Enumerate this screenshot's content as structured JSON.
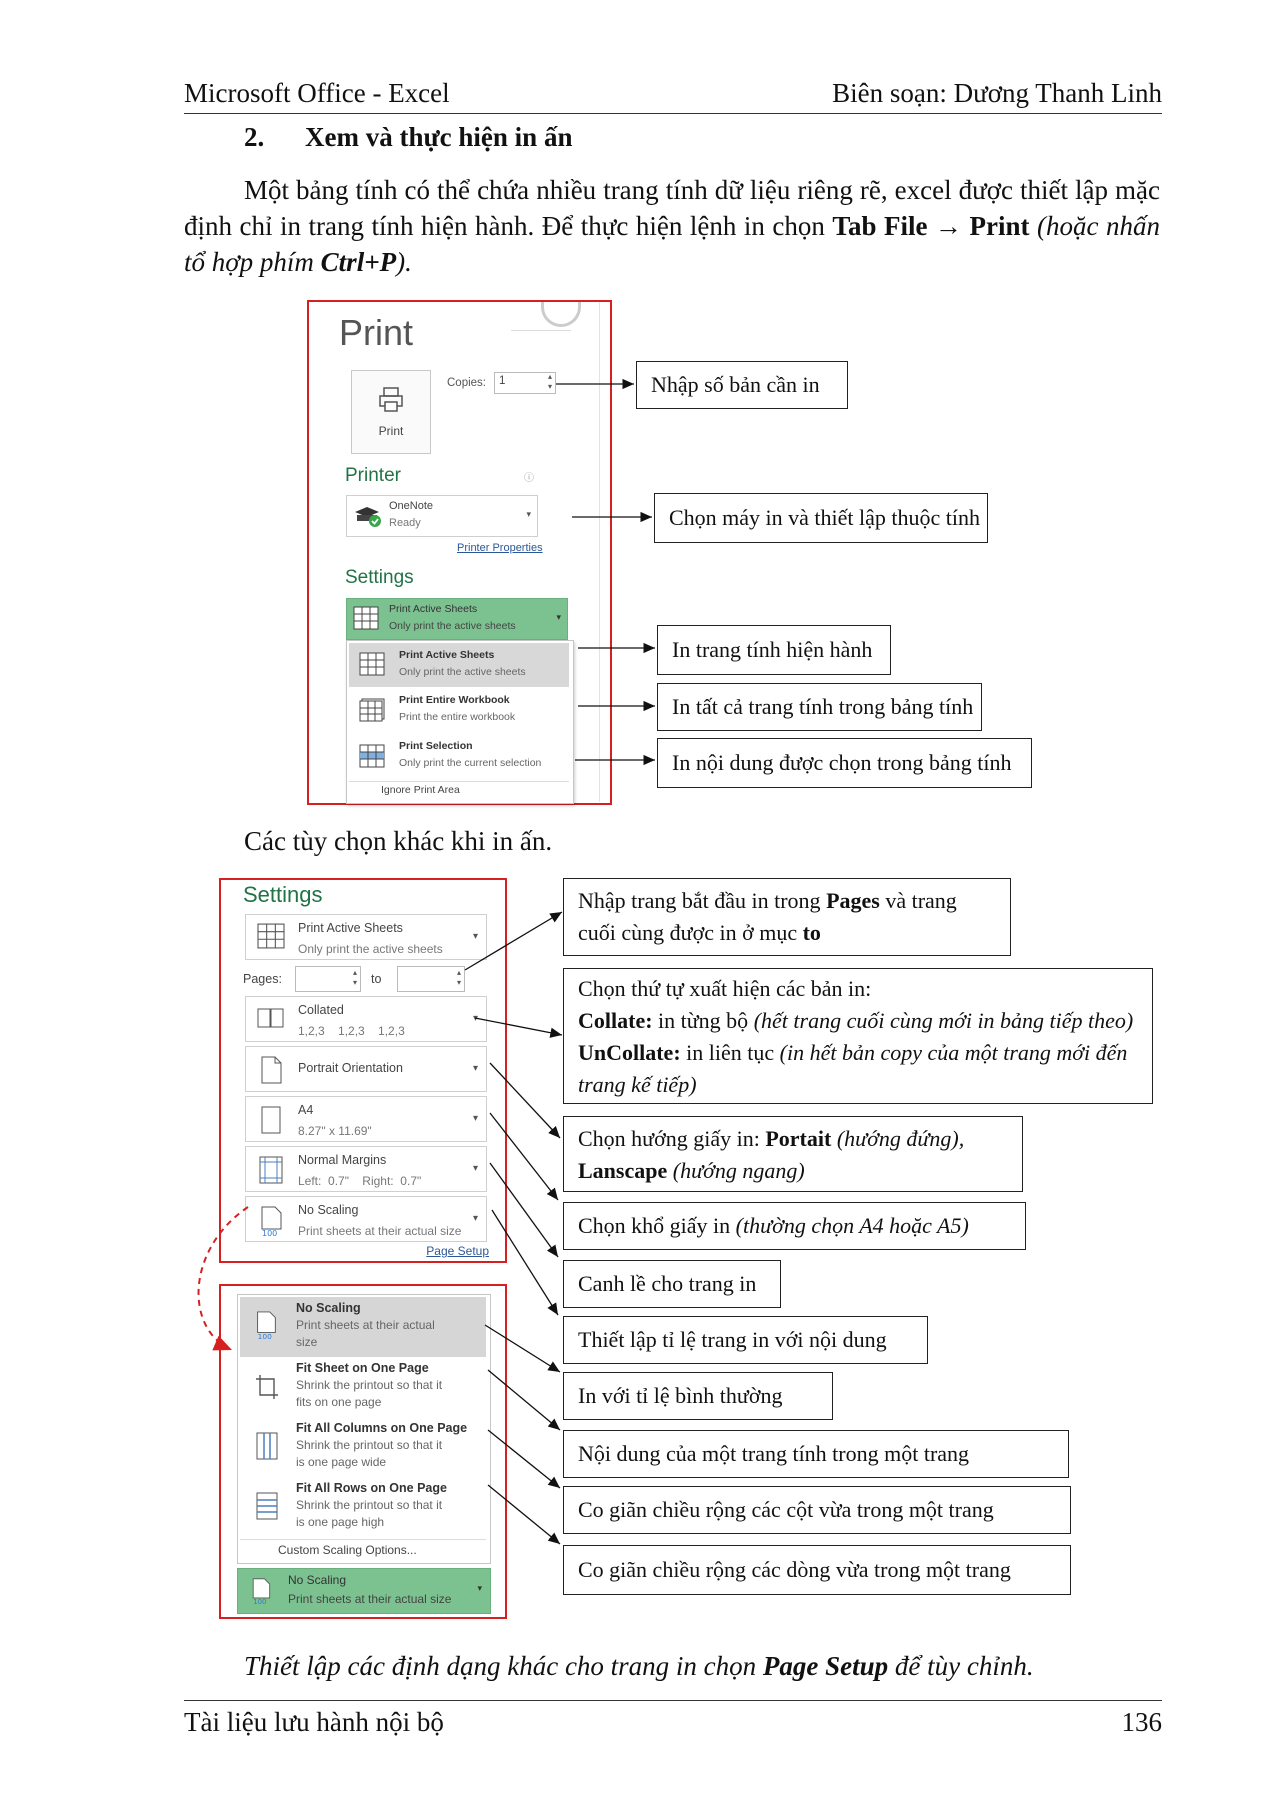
{
  "header": {
    "left": "Microsoft Office - Excel",
    "right": "Biên soạn: Dương Thanh Linh"
  },
  "section": {
    "number": "2.",
    "title": "Xem và thực hiện in ấn"
  },
  "intro": {
    "s1": "Một bảng tính có thể chứa nhiều trang tính dữ liệu riêng rẽ, excel được thiết lập mặc định chỉ in trang tính hiện hành. Để thực hiện lệnh in chọn ",
    "tab_file": "Tab File",
    "arrow": "→",
    "print_word": "Print",
    "s2": " (hoặc nhấn tổ hợp phím ",
    "shortcut": "Ctrl+P",
    "s3": ")."
  },
  "fig1": {
    "title": "Print",
    "copies_label": "Copies:",
    "copies_value": "1",
    "print_button": "Print",
    "printer_heading": "Printer",
    "printer_name": "OneNote",
    "printer_status": "Ready",
    "printer_properties": "Printer Properties",
    "settings_heading": "Settings",
    "active_line1": "Print Active Sheets",
    "active_line2": "Only print the active sheets",
    "menu": [
      {
        "t1": "Print Active Sheets",
        "t2": "Only print the active sheets"
      },
      {
        "t1": "Print Entire Workbook",
        "t2": "Print the entire workbook"
      },
      {
        "t1": "Print Selection",
        "t2": "Only print the current selection"
      }
    ],
    "ignore": "Ignore Print Area",
    "callouts": [
      "Nhập số bản cần in",
      "Chọn máy in và thiết lập thuộc tính",
      "In trang tính hiện hành",
      "In tất cả trang tính trong bảng tính",
      "In nội dung được chọn trong bảng tính"
    ]
  },
  "other_options": "Các tùy chọn khác khi in ấn.",
  "fig2": {
    "settings_heading": "Settings",
    "active_line1": "Print Active Sheets",
    "active_line2": "Only print the active sheets",
    "pages_label": "Pages:",
    "to_label": "to",
    "collated_1": "Collated",
    "collated_2": "1,2,3    1,2,3    1,2,3",
    "orientation": "Portrait Orientation",
    "paper_1": "A4",
    "paper_2": "8.27\" x 11.69\"",
    "margins_1": "Normal Margins",
    "margins_2": "Left:  0.7\"    Right:  0.7\"",
    "scaling_1": "No Scaling",
    "scaling_2": "Print sheets at their actual size",
    "page_setup": "Page Setup",
    "scale_menu": [
      {
        "t1": "No Scaling",
        "t2": "Print sheets at their actual",
        "t3": "size"
      },
      {
        "t1": "Fit Sheet on One Page",
        "t2": "Shrink the printout so that it",
        "t3": "fits on one page"
      },
      {
        "t1": "Fit All Columns on One Page",
        "t2": "Shrink the printout so that it",
        "t3": "is one page wide"
      },
      {
        "t1": "Fit All Rows on One Page",
        "t2": "Shrink the printout so that it",
        "t3": "is one page high"
      }
    ],
    "custom_scaling": "Custom Scaling Options...",
    "bottom_1": "No Scaling",
    "bottom_2": "Print sheets at their actual size",
    "callout_pages": {
      "a": "Nhập trang bắt đầu in trong ",
      "b": "Pages",
      "c": " và trang",
      "d": "cuối cùng được in ở mục ",
      "e": "to"
    },
    "callout_collate": {
      "l1": "Chọn thứ tự xuất hiện các bản in:",
      "c_bold": "Collate:",
      "c_text": " in từng bộ ",
      "c_ital": "(hết trang cuối cùng mới in bảng tiếp theo)",
      "u_bold": "UnCollate:",
      "u_text": " in liên tục ",
      "u_ital": "(in hết bản copy của một trang mới đến",
      "u_ital2": "trang kế tiếp)"
    },
    "callout_orient": {
      "a": "Chọn hướng giấy in: ",
      "b": "Portait",
      "c": " (hướng đứng),",
      "d": "Lanscape",
      "e": " (hướng ngang)"
    },
    "callout_paper": {
      "a": "Chọn khổ giấy in ",
      "b": "(thường chọn A4 hoặc A5)"
    },
    "callout_margin": "Canh lề cho trang in",
    "callout_scale": "Thiết lập tỉ lệ trang in với nội dung",
    "callout_normal": "In với tỉ lệ bình thường",
    "callout_fitsheet": "Nội dung của một trang tính trong một trang",
    "callout_fitcols": "Co giãn chiều rộng các cột vừa trong một trang",
    "callout_fitrows": "Co giãn chiều rộng các dòng vừa trong một trang"
  },
  "closing": {
    "a": "Thiết lập các định dạng khác cho trang in chọn ",
    "b": "Page Setup",
    "c": " để tùy chỉnh."
  },
  "footer": {
    "left": "Tài liệu lưu hành nội bộ",
    "right": "136"
  }
}
